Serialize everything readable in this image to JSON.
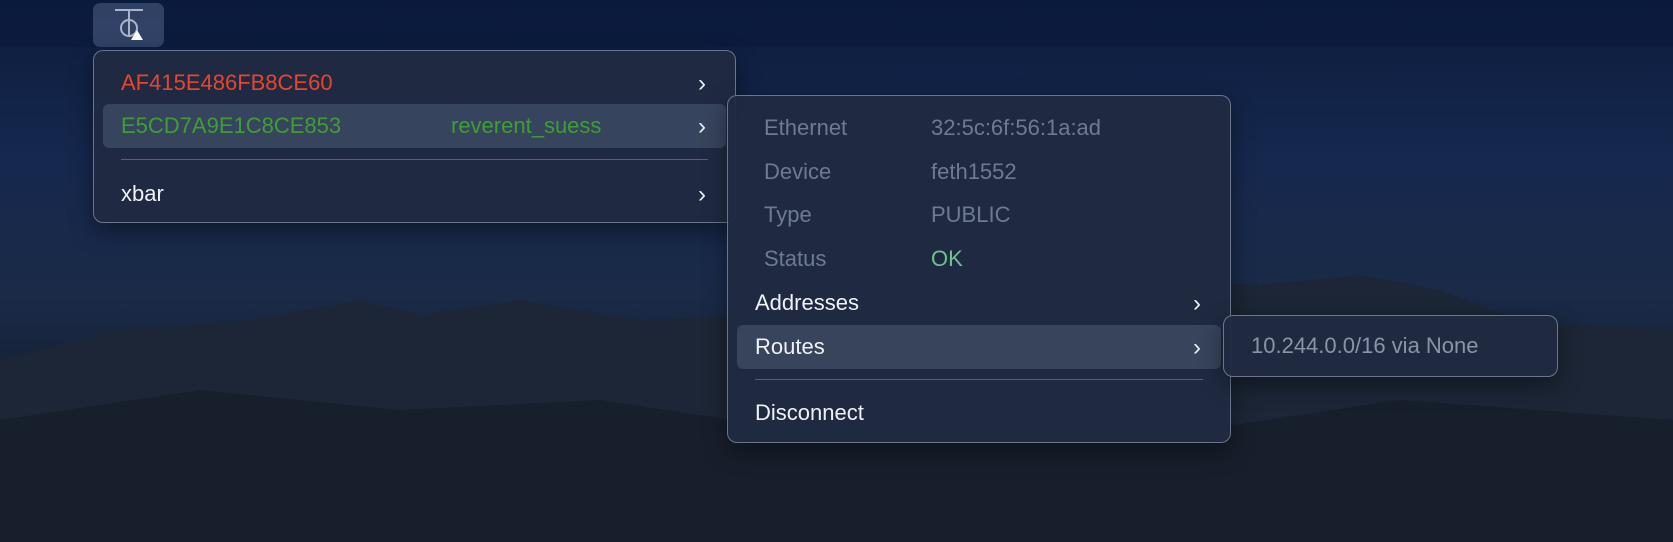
{
  "tray": {
    "icon": "xbar-icon"
  },
  "menu": {
    "items": [
      {
        "label": "AF415E486FB8CE60",
        "color": "#e8442e"
      },
      {
        "label": "E5CD7A9E1C8CE853",
        "extra": "reverent_suess",
        "color": "#3e9e34"
      },
      {
        "label": "xbar"
      }
    ]
  },
  "submenu": {
    "info": [
      {
        "label": "Ethernet",
        "value": "32:5c:6f:56:1a:ad"
      },
      {
        "label": "Device",
        "value": "feth1552"
      },
      {
        "label": "Type",
        "value": "PUBLIC"
      },
      {
        "label": "Status",
        "value": "OK",
        "value_color": "#6fc08a"
      }
    ],
    "addresses": "Addresses",
    "routes": "Routes",
    "disconnect": "Disconnect"
  },
  "routes_menu": {
    "items": [
      "10.244.0.0/16 via None"
    ]
  }
}
